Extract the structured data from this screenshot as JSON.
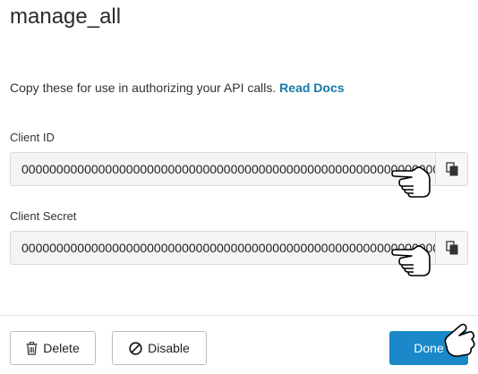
{
  "dialog": {
    "title": "manage_all",
    "description": "Copy these for use in authorizing your API calls.",
    "docs_link": "Read Docs"
  },
  "fields": [
    {
      "label": "Client ID",
      "value": "00000000000000000000000000000000000000000000000000000000000000"
    },
    {
      "label": "Client Secret",
      "value": "00000000000000000000000000000000000000000000000000000000000000"
    }
  ],
  "footer": {
    "delete_label": "Delete",
    "disable_label": "Disable",
    "done_label": "Done"
  },
  "icons": {
    "copy": "copy-icon",
    "trash": "trash-icon",
    "disable": "disable-icon",
    "cursor": "hand-pointer-icon"
  },
  "colors": {
    "link": "#1779a8",
    "primary": "#1a88c9"
  }
}
